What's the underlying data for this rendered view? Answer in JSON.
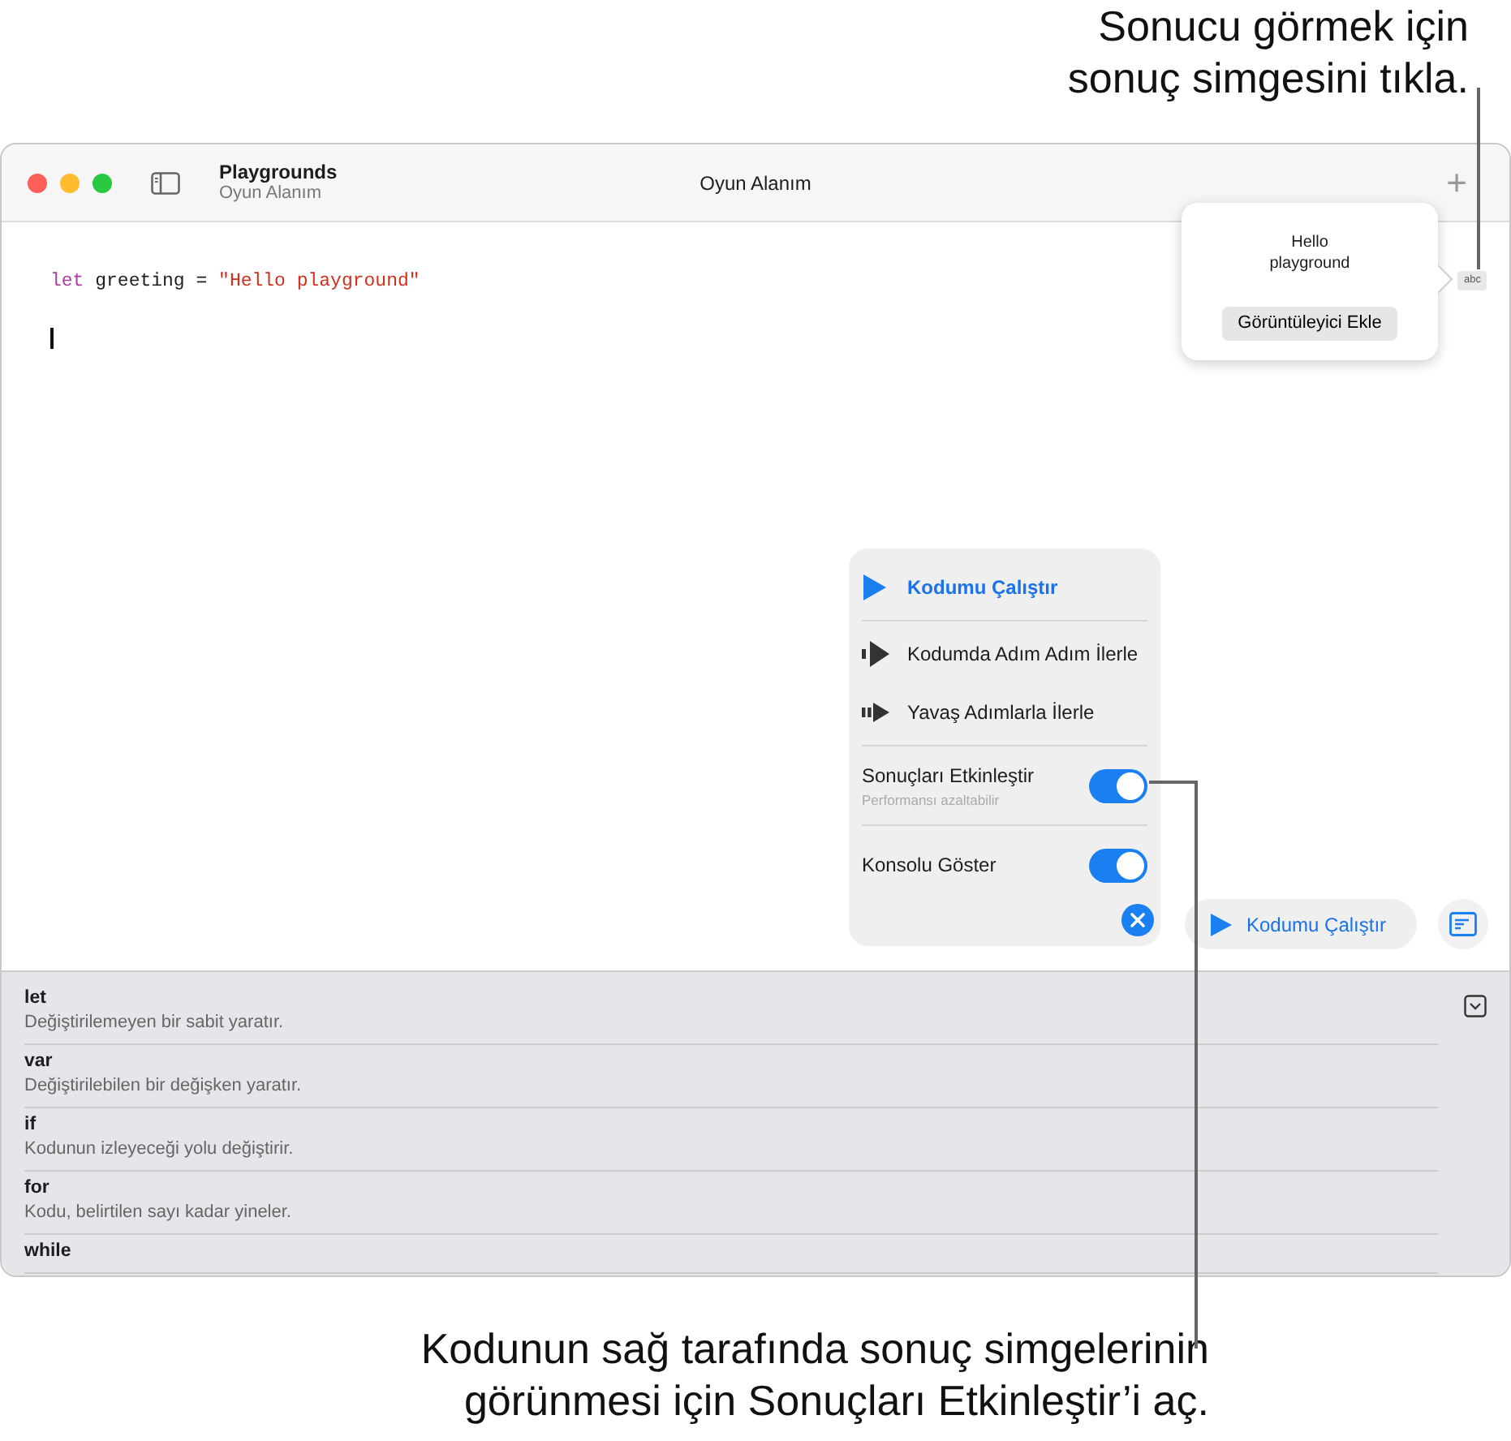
{
  "callouts": [
    {
      "kind": "top",
      "text": "Sonucu görmek için\nsonuç simgesini tıkla."
    },
    {
      "kind": "bottom",
      "text": "Kodunun sağ tarafında sonuç simgelerinin\ngörünmesi için Sonuçları Etkinleştir’i aç."
    }
  ],
  "window": {
    "app": "Playgrounds",
    "subtitle": "Oyun Alanım",
    "title": "Oyun Alanım",
    "add_button": "+"
  },
  "code": [
    {
      "kind": "keyword",
      "text": "let"
    },
    {
      "kind": "plain",
      "text": " greeting = "
    },
    {
      "kind": "string",
      "text": "\"Hello playground\""
    }
  ],
  "result_popover": {
    "value": "Hello\nplayground",
    "button": "Görüntüleyici Ekle",
    "badge": "abc"
  },
  "run_menu": [
    {
      "kind": "run",
      "label": "Kodumu Çalıştır"
    },
    {
      "kind": "step",
      "label": "Kodumda Adım Adım İlerle"
    },
    {
      "kind": "slow",
      "label": "Yavaş Adımlarla İlerle"
    },
    {
      "kind": "toggle",
      "label": "Sonuçları Etkinleştir",
      "note": "Performansı azaltabilir",
      "on": true
    },
    {
      "kind": "toggle",
      "label": "Konsolu Göster",
      "on": true
    }
  ],
  "run_button": "Kodumu Çalıştır",
  "suggestions": [
    {
      "keyword": "let",
      "description": "Değiştirilemeyen bir sabit yaratır."
    },
    {
      "keyword": "var",
      "description": "Değiştirilebilen bir değişken yaratır."
    },
    {
      "keyword": "if",
      "description": "Kodunun izleyeceği yolu değiştirir."
    },
    {
      "keyword": "for",
      "description": "Kodu, belirtilen sayı kadar yineler."
    },
    {
      "keyword": "while"
    }
  ]
}
